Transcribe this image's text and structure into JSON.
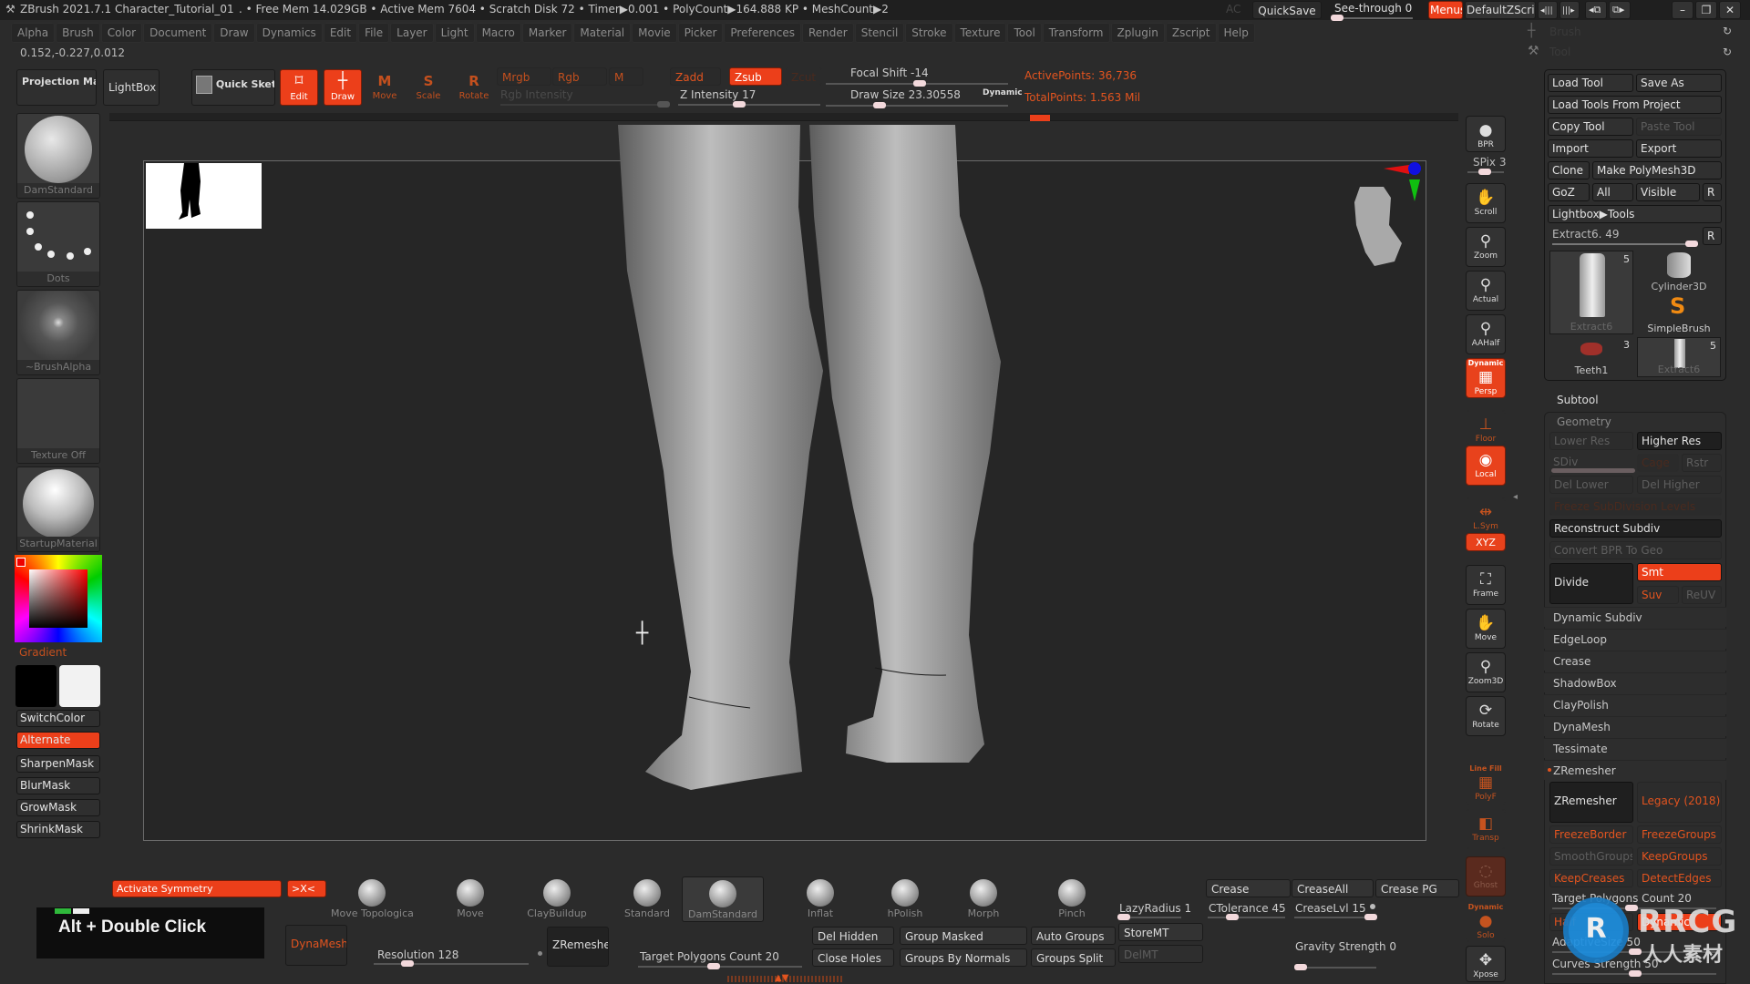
{
  "titlebar": {
    "app": "ZBrush 2021.7.1",
    "document": "Character_Tutorial_01",
    "stats": ". • Free Mem 14.029GB • Active Mem 7604 • Scratch Disk 72 •  Timer▶0.001 • PolyCount▶164.888 KP  • MeshCount▶2",
    "ac": "AC",
    "quicksave": "QuickSave",
    "see_through": "See-through  0",
    "see_through_value": 0,
    "menus": "Menus",
    "default_zscript": "DefaultZScript",
    "window_buttons": [
      "minimize",
      "restore",
      "close"
    ]
  },
  "menubar": [
    "Alpha",
    "Brush",
    "Color",
    "Document",
    "Draw",
    "Dynamics",
    "Edit",
    "File",
    "Layer",
    "Light",
    "Macro",
    "Marker",
    "Material",
    "Movie",
    "Picker",
    "Preferences",
    "Render",
    "Stencil",
    "Stroke",
    "Texture",
    "Tool",
    "Transform",
    "Zplugin",
    "Zscript",
    "Help"
  ],
  "coords": "0.152,-0.227,0.012",
  "top_right_icons": [
    {
      "label": "Brush",
      "icon": "crosshair-icon"
    },
    {
      "label": "Tool",
      "icon": "hammer-icon"
    }
  ],
  "toolbar": {
    "projection_master": "Projection Master",
    "lightbox": "LightBox",
    "quick_sketch": "Quick Sketch",
    "edit": "Edit",
    "draw": "Draw",
    "move": "Move",
    "scale": "Scale",
    "rotate": "Rotate",
    "mrgb": "Mrgb",
    "rgb": "Rgb",
    "m": "M",
    "rgb_intensity": "Rgb Intensity",
    "zadd": "Zadd",
    "zsub": "Zsub",
    "zcut": "Zcut",
    "z_intensity": "Z Intensity 17",
    "z_intensity_value": 17,
    "focal_shift": "Focal Shift -14",
    "focal_shift_value": -14,
    "draw_size": "Draw Size 23.30558",
    "draw_size_value": 23.30558,
    "dynamic": "Dynamic",
    "active_points": "ActivePoints: 36,736",
    "total_points": "TotalPoints: 1.563 Mil"
  },
  "left_tray": {
    "brush": "DamStandard",
    "stroke": "Dots",
    "alpha": "~BrushAlpha",
    "texture": "Texture Off",
    "material": "StartupMaterial",
    "gradient": "Gradient",
    "buttons": [
      "SwitchColor",
      "Alternate",
      "SharpenMask",
      "BlurMask",
      "GrowMask",
      "ShrinkMask"
    ]
  },
  "right_shelf": [
    {
      "label": "BPR",
      "icon": "bpr-sphere-icon",
      "state": "normal"
    },
    {
      "label": "SPix 3",
      "icon": "",
      "state": "slider"
    },
    {
      "label": "Scroll",
      "icon": "hand-scroll-icon",
      "state": "normal"
    },
    {
      "label": "Zoom",
      "icon": "zoom-icon",
      "state": "normal"
    },
    {
      "label": "Actual",
      "icon": "zoom-actual-icon",
      "state": "normal"
    },
    {
      "label": "AAHalf",
      "icon": "zoom-aahalf-icon",
      "state": "normal"
    },
    {
      "label": "Persp",
      "icon": "perspective-grid-icon",
      "state": "on",
      "sub": "Dynamic"
    },
    {
      "label": "Floor",
      "icon": "floor-icon",
      "state": "off"
    },
    {
      "label": "Local",
      "icon": "local-sphere-icon",
      "state": "on"
    },
    {
      "label": "L.Sym",
      "icon": "local-symmetry-icon",
      "state": "off"
    },
    {
      "label": "XYZ",
      "icon": "xyz-rotate-icon",
      "state": "on"
    },
    {
      "label": "Frame",
      "icon": "frame-icon",
      "state": "normal"
    },
    {
      "label": "Move",
      "icon": "move-hand-icon",
      "state": "normal"
    },
    {
      "label": "Zoom3D",
      "icon": "zoom3d-icon",
      "state": "normal"
    },
    {
      "label": "Rotate",
      "icon": "rotate-icon",
      "state": "normal"
    },
    {
      "label": "PolyF",
      "icon": "polyframe-icon",
      "state": "off",
      "sub": "Line Fill"
    },
    {
      "label": "Transp",
      "icon": "transparency-icon",
      "state": "off"
    },
    {
      "label": "Ghost",
      "icon": "ghost-icon",
      "state": "dim"
    },
    {
      "label": "Solo",
      "icon": "solo-icon",
      "state": "off",
      "sub": "Dynamic"
    },
    {
      "label": "Xpose",
      "icon": "xpose-icon",
      "state": "normal"
    }
  ],
  "tool_palette": {
    "load_tool": "Load Tool",
    "save_as": "Save As",
    "load_from_project": "Load Tools From Project",
    "copy_tool": "Copy Tool",
    "paste_tool": "Paste Tool",
    "import": "Import",
    "export": "Export",
    "clone": "Clone",
    "make_polymesh": "Make PolyMesh3D",
    "goz": "GoZ",
    "all": "All",
    "visible": "Visible",
    "r": "R",
    "lightbox_tools": "Lightbox▶Tools",
    "current_tool": "Extract6. 49",
    "current_tool_value": 49,
    "tools": [
      {
        "name": "Extract6",
        "count": "5"
      },
      {
        "name": "Cylinder3D",
        "count": ""
      },
      {
        "name": "SimpleBrush",
        "count": ""
      },
      {
        "name": "Teeth1",
        "count": "3"
      },
      {
        "name": "Extract6",
        "count": "5"
      }
    ],
    "subtool": "Subtool",
    "geometry": "Geometry",
    "lower_res": "Lower Res",
    "higher_res": "Higher Res",
    "sdiv": "SDiv",
    "cage": "Cage",
    "rstr": "Rstr",
    "del_lower": "Del Lower",
    "del_higher": "Del Higher",
    "freeze_subdiv": "Freeze SubDivision Levels",
    "reconstruct_subdiv": "Reconstruct Subdiv",
    "convert_bpr": "Convert BPR To Geo",
    "divide": "Divide",
    "smt": "Smt",
    "suv": "Suv",
    "reuv": "ReUV",
    "sections": [
      "Dynamic Subdiv",
      "EdgeLoop",
      "Crease",
      "ShadowBox",
      "ClayPolish",
      "DynaMesh",
      "Tessimate",
      "ZRemesher"
    ],
    "zremesher": "ZRemesher",
    "legacy": "Legacy (2018)",
    "freeze_border": "FreezeBorder",
    "freeze_groups": "FreezeGroups",
    "smooth_groups": "SmoothGroups",
    "keep_groups": "KeepGroups",
    "keep_creases": "KeepCreases",
    "detect_edges": "DetectEdges",
    "target_polygons": "Target Polygons Count 20",
    "half": "Half",
    "dynamic_btn": "Dynamic",
    "adaptive_size": "AdaptiveSize 50",
    "curves_strength": "Curves Strength 50"
  },
  "bottom_shelf": {
    "activate_symmetry": "Activate Symmetry",
    "x_sym": ">X<",
    "brushes": [
      "Move Topologica",
      "Move",
      "ClayBuildup",
      "Standard",
      "DamStandard",
      "Inflat",
      "hPolish",
      "Morph",
      "Pinch"
    ],
    "lazy_radius": "LazyRadius 1",
    "crease": "Crease",
    "crease_all": "CreaseAll",
    "crease_pg": "Crease PG",
    "ctolerance": "CTolerance 45",
    "crease_lvl": "CreaseLvl 15",
    "dynamesh": "DynaMesh",
    "resolution": "Resolution 128",
    "zremesher": "ZRemesher",
    "target_polygons": "Target Polygons Count 20",
    "del_hidden": "Del Hidden",
    "close_holes": "Close Holes",
    "group_masked": "Group Masked",
    "groups_by_normals": "Groups By Normals",
    "auto_groups": "Auto Groups",
    "groups_split": "Groups Split",
    "store_mt": "StoreMT",
    "del_mt": "DelMT",
    "gravity_strength": "Gravity Strength 0"
  },
  "overlay": {
    "keystroke": "Alt + Double Click",
    "watermark": "RRCG",
    "watermark_sub": "人人素材"
  },
  "colors": {
    "accent": "#ec3f1a",
    "panel": "#303030",
    "background": "#2b2b2b"
  }
}
